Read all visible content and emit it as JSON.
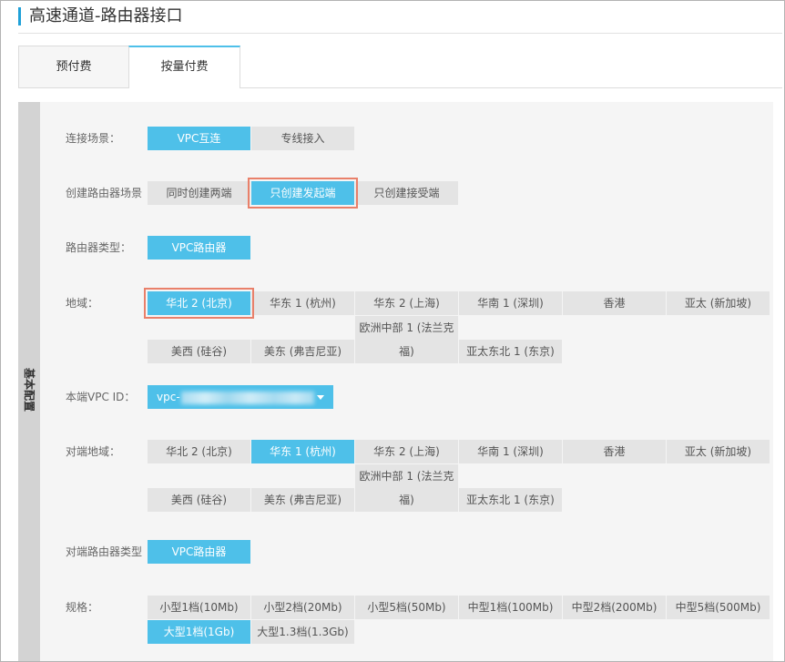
{
  "page": {
    "title": "高速通道-路由器接口"
  },
  "tabs": [
    {
      "label": "预付费"
    },
    {
      "label": "按量付费",
      "active": true
    }
  ],
  "panel": {
    "section_label": "基本配置"
  },
  "form": {
    "connection_scenario": {
      "label": "连接场景：",
      "options": [
        {
          "label": "VPC互连",
          "selected": true
        },
        {
          "label": "专线接入"
        }
      ]
    },
    "create_scenario": {
      "label": "创建路由器场景",
      "options": [
        {
          "label": "同时创建两端"
        },
        {
          "label": "只创建发起端",
          "selected": true,
          "annotated": true
        },
        {
          "label": "只创建接受端"
        }
      ]
    },
    "router_type": {
      "label": "路由器类型：",
      "options": [
        {
          "label": "VPC路由器",
          "selected": true
        }
      ]
    },
    "region": {
      "label": "地域：",
      "options": [
        {
          "label": "华北 2 (北京)",
          "selected": true,
          "annotated": true
        },
        {
          "label": "华东 1 (杭州)"
        },
        {
          "label": "华东 2 (上海)"
        },
        {
          "label": "华南 1 (深圳)"
        },
        {
          "label": "香港"
        },
        {
          "label": "亚太 (新加坡)"
        },
        {
          "label": "美西 (硅谷)"
        },
        {
          "label": "美东 (弗吉尼亚)"
        },
        {
          "label": "欧洲中部 1 (法兰克福)"
        },
        {
          "label": "亚太东北 1 (东京)"
        }
      ]
    },
    "local_vpc_id": {
      "label": "本端VPC ID：",
      "value": "vpc-"
    },
    "peer_region": {
      "label": "对端地域：",
      "options": [
        {
          "label": "华北 2 (北京)"
        },
        {
          "label": "华东 1 (杭州)",
          "selected": true
        },
        {
          "label": "华东 2 (上海)"
        },
        {
          "label": "华南 1 (深圳)"
        },
        {
          "label": "香港"
        },
        {
          "label": "亚太 (新加坡)"
        },
        {
          "label": "美西 (硅谷)"
        },
        {
          "label": "美东 (弗吉尼亚)"
        },
        {
          "label": "欧洲中部 1 (法兰克福)"
        },
        {
          "label": "亚太东北 1 (东京)"
        }
      ]
    },
    "peer_router_type": {
      "label": "对端路由器类型",
      "options": [
        {
          "label": "VPC路由器",
          "selected": true
        }
      ]
    },
    "spec": {
      "label": "规格：",
      "options": [
        {
          "label": "小型1档(10Mb)"
        },
        {
          "label": "小型2档(20Mb)"
        },
        {
          "label": "小型5档(50Mb)"
        },
        {
          "label": "中型1档(100Mb)"
        },
        {
          "label": "中型2档(200Mb)"
        },
        {
          "label": "中型5档(500Mb)"
        },
        {
          "label": "大型1档(1Gb)",
          "selected": true
        },
        {
          "label": "大型1.3档(1.3Gb)"
        }
      ]
    }
  },
  "colors": {
    "accent": "#4ec0e9",
    "title_accent": "#1fa0d8",
    "annotation": "#e9806a"
  }
}
